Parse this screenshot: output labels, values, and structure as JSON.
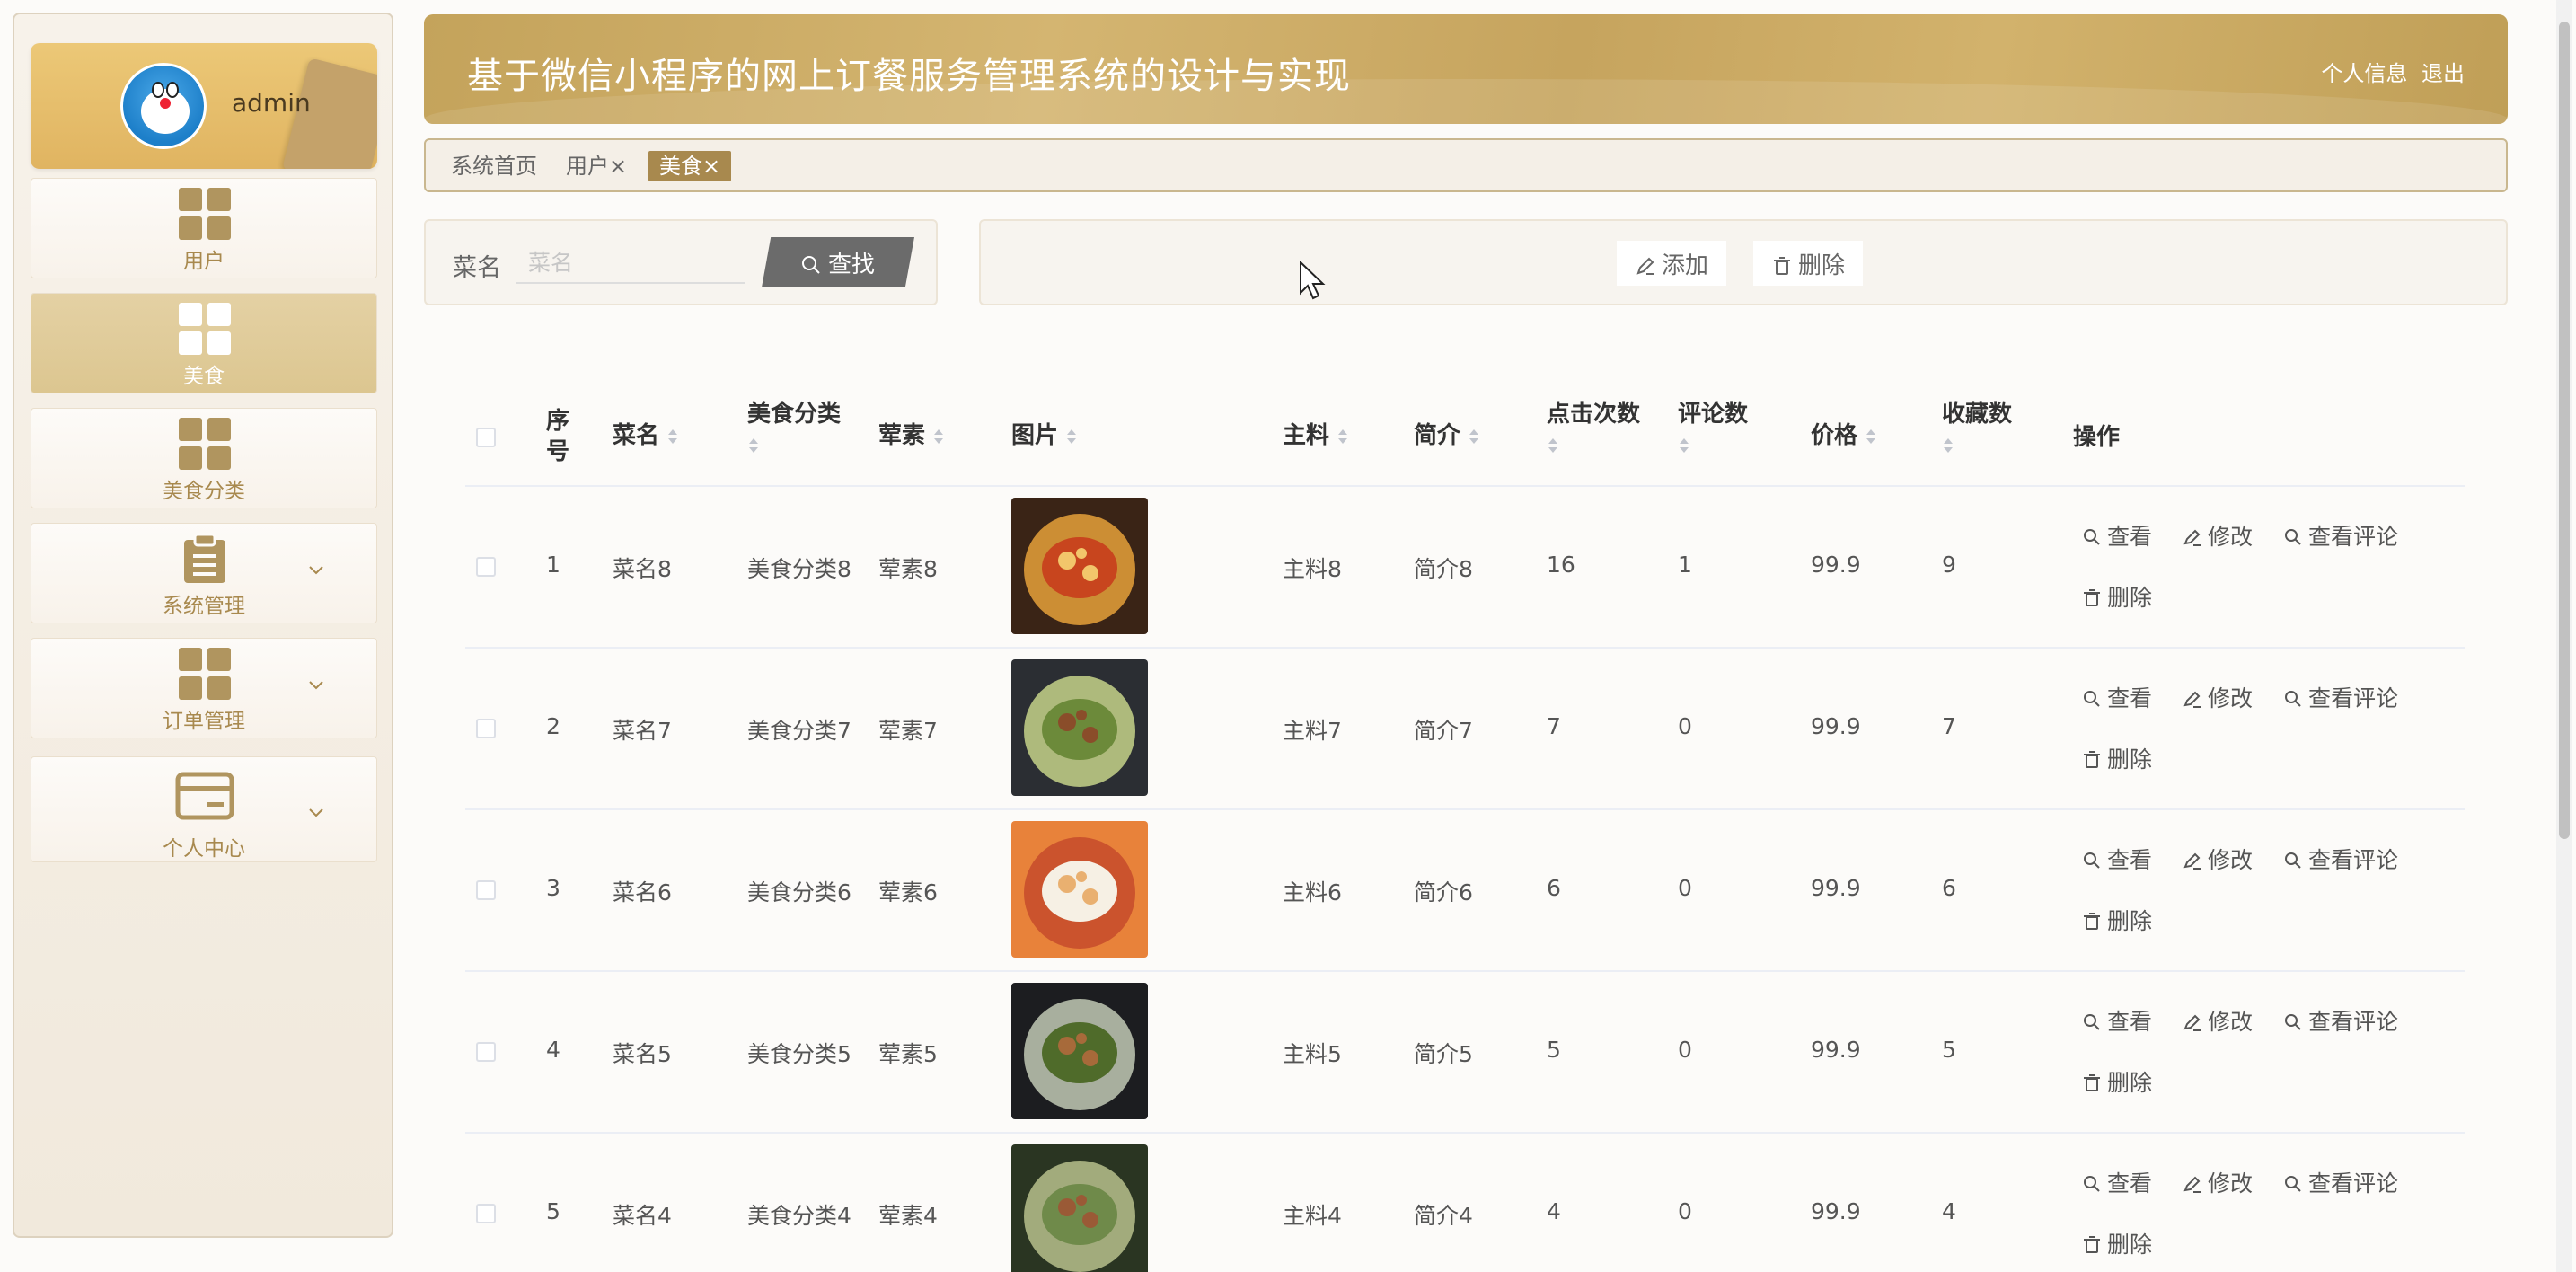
{
  "sidebar": {
    "user_name": "admin",
    "items": [
      {
        "label": "用户",
        "icon": "grid-icon",
        "active": false
      },
      {
        "label": "美食",
        "icon": "grid-icon",
        "active": true
      },
      {
        "label": "美食分类",
        "icon": "grid-icon",
        "active": false
      },
      {
        "label": "系统管理",
        "icon": "clipboard-icon",
        "active": false
      },
      {
        "label": "订单管理",
        "icon": "grid-icon",
        "active": false
      },
      {
        "label": "个人中心",
        "icon": "card-icon",
        "active": false
      }
    ]
  },
  "header": {
    "title": "基于微信小程序的网上订餐服务管理系统的设计与实现",
    "profile_link": "个人信息",
    "logout_link": "退出"
  },
  "tags": [
    {
      "label": "系统首页"
    },
    {
      "label": "用户×"
    },
    {
      "label": "美食×"
    }
  ],
  "search": {
    "label": "菜名",
    "placeholder": "菜名",
    "button": "查找"
  },
  "actions": {
    "add": "添加",
    "delete": "删除"
  },
  "table": {
    "headers": {
      "index_1": "序",
      "index_2": "号",
      "name": "菜名",
      "category": "美食分类",
      "type": "荤素",
      "image": "图片",
      "ingredient": "主料",
      "intro": "简介",
      "clicks": "点击次数",
      "comments": "评论数",
      "price": "价格",
      "favorites": "收藏数",
      "ops": "操作"
    },
    "ops": {
      "view": "查看",
      "edit": "修改",
      "view_comments": "查看评论",
      "delete": "删除"
    },
    "rows": [
      {
        "index": "1",
        "name": "菜名8",
        "category": "美食分类8",
        "type": "荤素8",
        "ingredient": "主料8",
        "intro": "简介8",
        "clicks": "16",
        "comments": "1",
        "price": "99.9",
        "favorites": "9"
      },
      {
        "index": "2",
        "name": "菜名7",
        "category": "美食分类7",
        "type": "荤素7",
        "ingredient": "主料7",
        "intro": "简介7",
        "clicks": "7",
        "comments": "0",
        "price": "99.9",
        "favorites": "7"
      },
      {
        "index": "3",
        "name": "菜名6",
        "category": "美食分类6",
        "type": "荤素6",
        "ingredient": "主料6",
        "intro": "简介6",
        "clicks": "6",
        "comments": "0",
        "price": "99.9",
        "favorites": "6"
      },
      {
        "index": "4",
        "name": "菜名5",
        "category": "美食分类5",
        "type": "荤素5",
        "ingredient": "主料5",
        "intro": "简介5",
        "clicks": "5",
        "comments": "0",
        "price": "99.9",
        "favorites": "5"
      },
      {
        "index": "5",
        "name": "菜名4",
        "category": "美食分类4",
        "type": "荤素4",
        "ingredient": "主料4",
        "intro": "简介4",
        "clicks": "4",
        "comments": "0",
        "price": "99.9",
        "favorites": "4"
      }
    ]
  },
  "colors": {
    "brand": "#c4a35b",
    "accent": "#a8894e",
    "sidebar_bg": "#f3ece1"
  }
}
